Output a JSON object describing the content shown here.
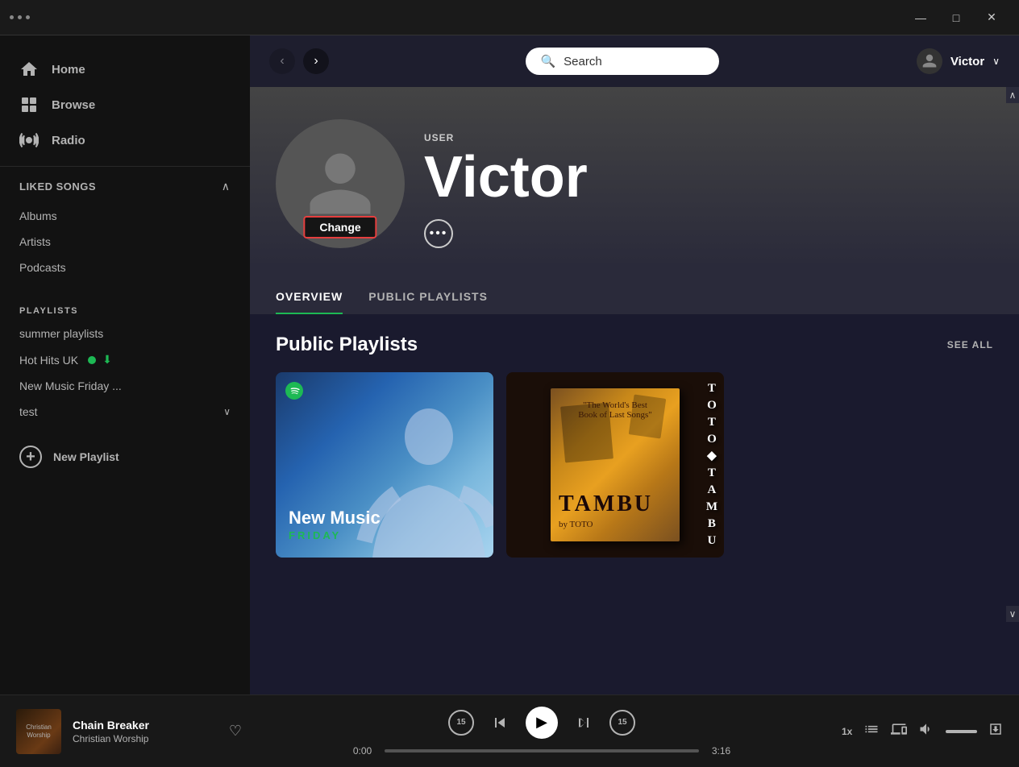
{
  "titleBar": {
    "dots": [
      "dot",
      "dot",
      "dot"
    ],
    "windowControls": {
      "minimize": "—",
      "maximize": "□",
      "close": "✕"
    }
  },
  "topNav": {
    "backArrow": "‹",
    "forwardArrow": "›",
    "search": {
      "placeholder": "Search",
      "icon": "🔍"
    },
    "user": {
      "name": "Victor",
      "chevron": "∨"
    }
  },
  "sidebar": {
    "navItems": [
      {
        "id": "home",
        "label": "Home",
        "icon": "home"
      },
      {
        "id": "browse",
        "label": "Browse",
        "icon": "browse"
      },
      {
        "id": "radio",
        "label": "Radio",
        "icon": "radio"
      }
    ],
    "libraryHeader": "Liked Songs",
    "libraryItems": [
      {
        "label": "Albums"
      },
      {
        "label": "Artists"
      },
      {
        "label": "Podcasts"
      }
    ],
    "playlistsLabel": "PLAYLISTS",
    "playlists": [
      {
        "label": "summer playlists",
        "hasIcon": false
      },
      {
        "label": "Hot Hits UK",
        "hasGreenDot": true,
        "hasDownload": true
      },
      {
        "label": "New Music Friday ...",
        "hasIcon": false
      },
      {
        "label": "test",
        "hasChevron": true
      }
    ],
    "newPlaylist": "New Playlist"
  },
  "profile": {
    "userLabel": "USER",
    "name": "Victor",
    "changeBtn": "Change",
    "moreBtnLabel": "•••",
    "tabs": [
      {
        "id": "overview",
        "label": "OVERVIEW",
        "active": true
      },
      {
        "id": "public-playlists",
        "label": "PUBLIC PLAYLISTS",
        "active": false
      }
    ],
    "publicPlaylists": {
      "title": "Public Playlists",
      "seeAll": "SEE ALL",
      "cards": [
        {
          "id": "new-music-friday",
          "title": "New Music",
          "subtitle": "FRIDAY",
          "type": "new-music"
        },
        {
          "id": "toto-tambu",
          "title": "TOTO◆TAMBU",
          "type": "toto"
        }
      ]
    }
  },
  "player": {
    "track": {
      "title": "Chain Breaker",
      "artist": "Christian Worship",
      "albumLabel": "Christian Worship"
    },
    "currentTime": "0:00",
    "totalTime": "3:16",
    "speed": "1x",
    "skipBack": "15",
    "skipForward": "15"
  },
  "scrollbar": {
    "upArrow": "∧",
    "downArrow": "∨"
  }
}
